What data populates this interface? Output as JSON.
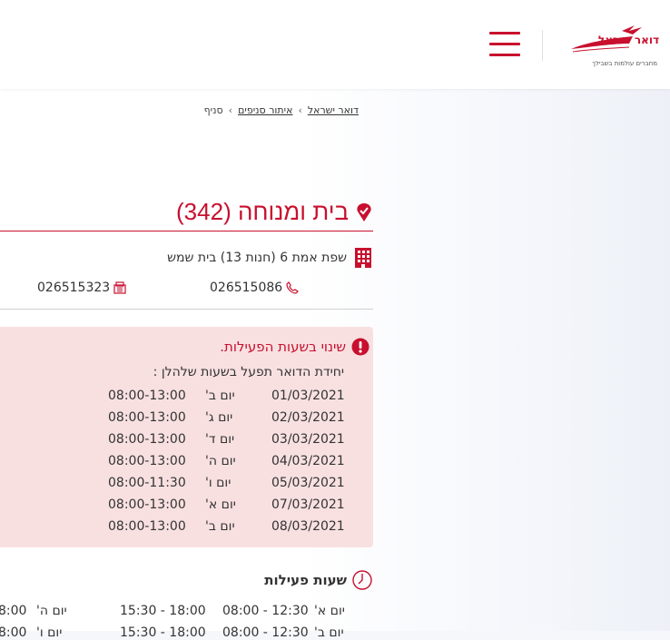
{
  "header": {
    "logo_name": "דואר ישראל",
    "logo_tagline": "מחברים עולמות בשבילך",
    "menu_icon": "hamburger-icon",
    "brand_color": "#c8102e"
  },
  "breadcrumb": {
    "items": [
      "דואר ישראל",
      "איתור סניפים",
      "סניף"
    ],
    "separator": "›"
  },
  "branch": {
    "title": "בית ומנוחה (342)",
    "title_icon": "location-pin-icon",
    "address": "שפת אמת 6 (חנות 13) בית שמש",
    "address_icon": "building-icon",
    "phone": "026515086",
    "phone_icon": "phone-icon",
    "fax": "026515323",
    "fax_icon": "fax-icon"
  },
  "notice": {
    "title": "שינוי בשעות הפעילות.",
    "icon": "alert-icon",
    "subtitle": "יחידת הדואר תפעל בשעות שלהלן :",
    "rows": [
      {
        "date": "01/03/2021",
        "day": "יום ב'",
        "hours": "08:00-13:00"
      },
      {
        "date": "02/03/2021",
        "day": "יום ג'",
        "hours": "08:00-13:00"
      },
      {
        "date": "03/03/2021",
        "day": "יום ד'",
        "hours": "08:00-13:00"
      },
      {
        "date": "04/03/2021",
        "day": "יום ה'",
        "hours": "08:00-13:00"
      },
      {
        "date": "05/03/2021",
        "day": "יום ו'",
        "hours": "08:00-11:30"
      },
      {
        "date": "07/03/2021",
        "day": "יום א'",
        "hours": "08:00-13:00"
      },
      {
        "date": "08/03/2021",
        "day": "יום ב'",
        "hours": "08:00-13:00"
      }
    ]
  },
  "hours": {
    "title": "שעות פעילות",
    "icon": "clock-icon",
    "rows": [
      {
        "day": "יום א'",
        "morning": "08:00 - 12:30",
        "evening": "15:30 - 18:00",
        "day2": "יום ה'",
        "morning2": "8:00"
      },
      {
        "day": "יום ב'",
        "morning": "08:00 - 12:30",
        "evening": "15:30 - 18:00",
        "day2": "יום ו'",
        "morning2": "8:00"
      }
    ]
  }
}
